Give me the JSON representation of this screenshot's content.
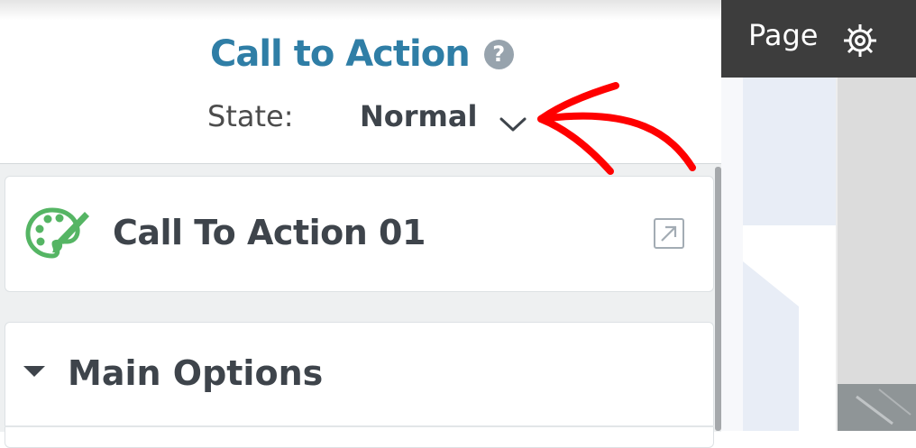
{
  "panel": {
    "title": "Call to Action",
    "state_label": "State:",
    "state_value": "Normal",
    "widget_name": "Call To Action 01",
    "section_title": "Main Options"
  },
  "topbar": {
    "page_label": "Page"
  },
  "icons": {
    "help": "question-mark-icon",
    "dropdown": "chevron-down-icon",
    "widget": "palette-icon",
    "open": "external-link-icon",
    "section_toggle": "triangle-down-icon",
    "settings": "gear-icon",
    "annotation": "red-arrow-annotation"
  },
  "colors": {
    "title": "#2f7ea6",
    "palette_icon": "#55b564",
    "annotation": "#ff0000",
    "topbar": "#3d3d3d"
  }
}
